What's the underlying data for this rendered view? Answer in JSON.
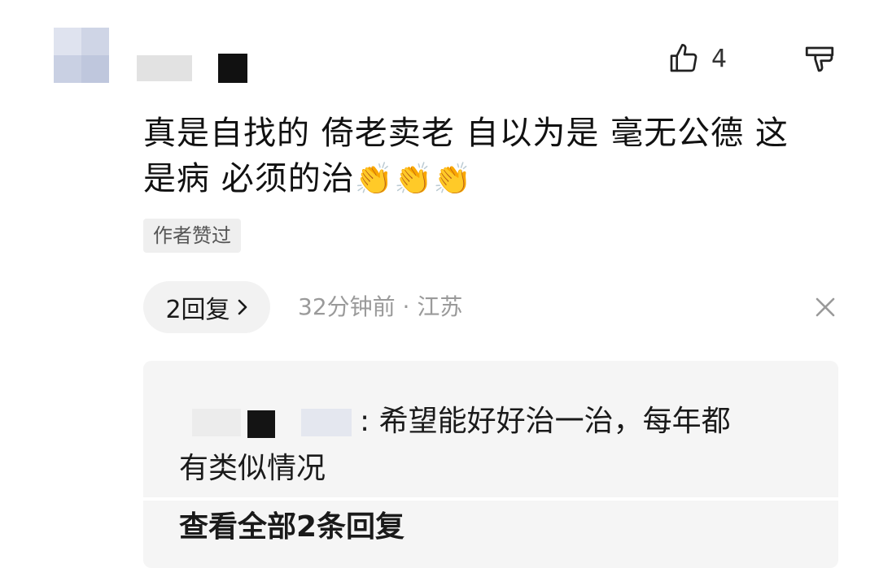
{
  "comment": {
    "like_count": "4",
    "text_line1": "真是自找的 倚老卖老 自以为是 毫无公德 这",
    "text_line2": "是病 必须的治",
    "emoji": [
      "👏",
      "👏",
      "👏"
    ],
    "author_liked_tag": "作者赞过",
    "reply_button": "2回复",
    "time_location": "32分钟前 · 江苏"
  },
  "reply_preview": {
    "separator": ":",
    "text_line1": "希望能好好治一治，每年都",
    "text_line2": "有类似情况",
    "view_all": "查看全部2条回复"
  },
  "icons": {
    "like": "thumbs-up-icon",
    "dislike": "thumbs-down-icon",
    "close": "close-icon",
    "chevron": "chevron-right-icon"
  }
}
